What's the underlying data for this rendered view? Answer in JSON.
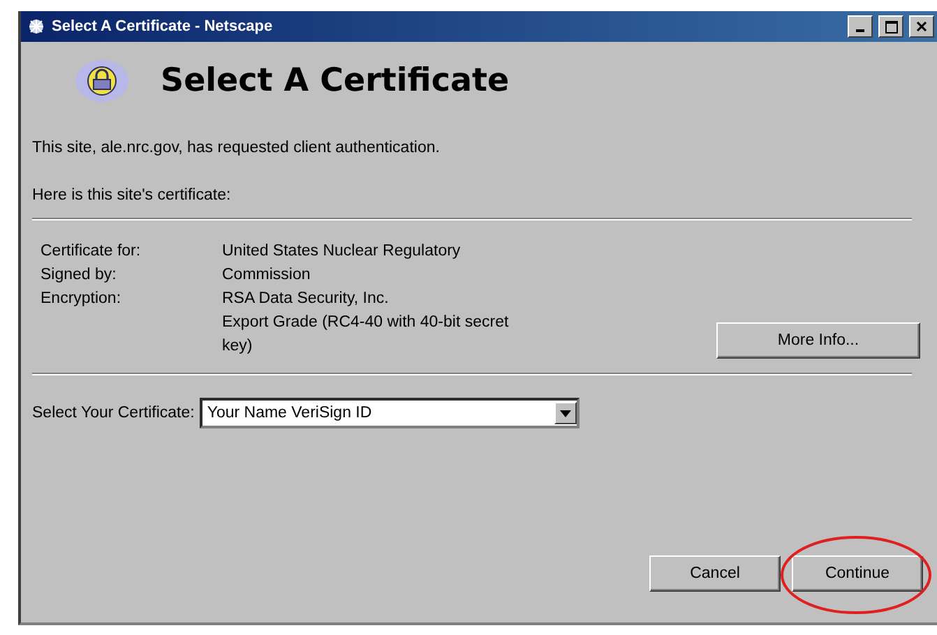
{
  "window": {
    "title": "Select A Certificate - Netscape"
  },
  "heading": "Select A Certificate",
  "intro": "This site, ale.nrc.gov, has requested client authentication.",
  "certificate_caption": "Here is this site's certificate:",
  "certificate": {
    "labels": [
      "Certificate for:",
      "Signed by:",
      "Encryption:"
    ],
    "value_lines": [
      "United States Nuclear Regulatory",
      "Commission",
      "RSA Data Security, Inc.",
      "Export Grade (RC4-40 with 40-bit secret",
      "key)"
    ]
  },
  "more_info_button": "More Info...",
  "select": {
    "label": "Select Your Certificate:",
    "value": "Your Name VeriSign ID"
  },
  "buttons": [
    {
      "label": "Cancel",
      "circled": false
    },
    {
      "label": "Continue",
      "circled": true
    }
  ]
}
